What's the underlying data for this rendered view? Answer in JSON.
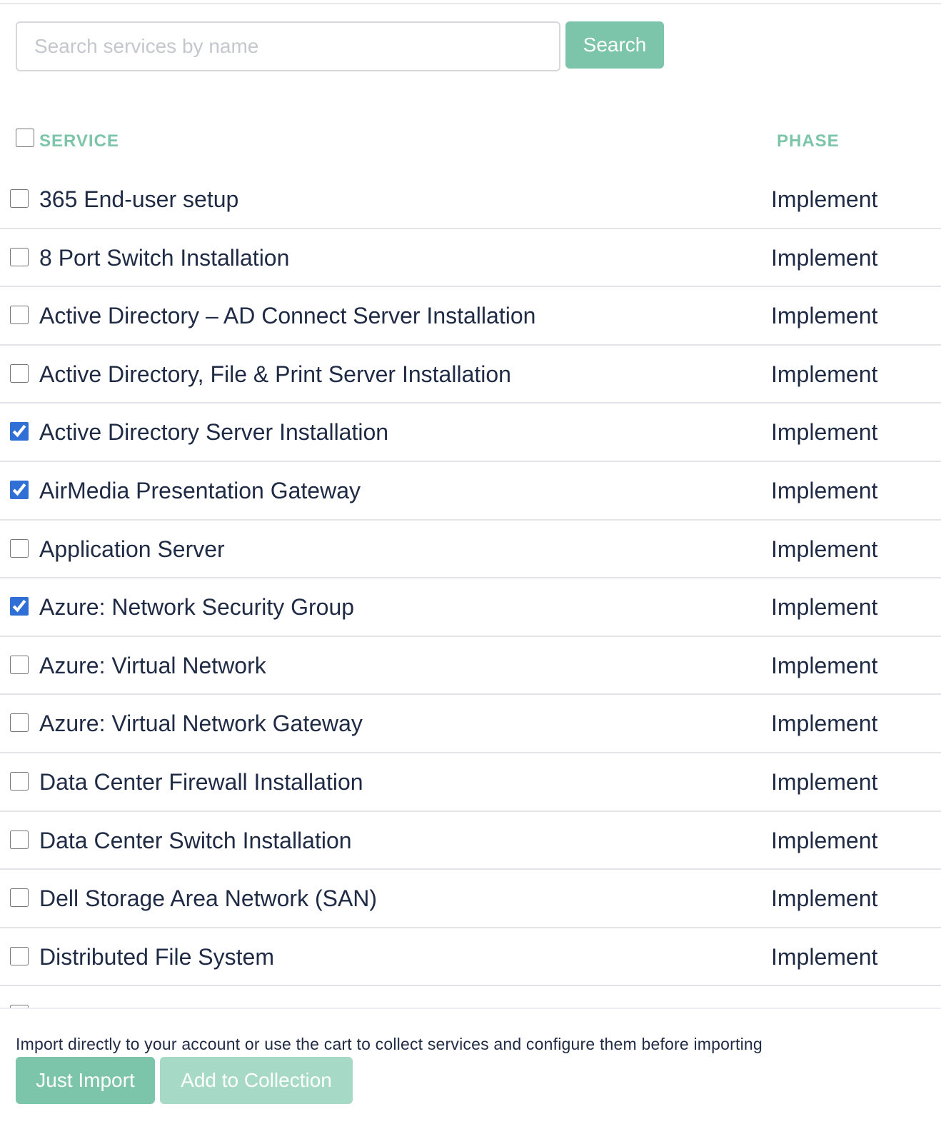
{
  "search": {
    "placeholder": "Search services by name",
    "value": "",
    "button_label": "Search"
  },
  "table": {
    "headers": {
      "service": "SERVICE",
      "phase": "PHASE"
    },
    "select_all_checked": false,
    "rows": [
      {
        "name": "365 End-user setup",
        "phase": "Implement",
        "checked": false
      },
      {
        "name": "8 Port Switch Installation",
        "phase": "Implement",
        "checked": false
      },
      {
        "name": "Active Directory – AD Connect Server Installation",
        "phase": "Implement",
        "checked": false
      },
      {
        "name": "Active Directory, File & Print Server Installation",
        "phase": "Implement",
        "checked": false
      },
      {
        "name": "Active Directory Server Installation",
        "phase": "Implement",
        "checked": true
      },
      {
        "name": "AirMedia Presentation Gateway",
        "phase": "Implement",
        "checked": true
      },
      {
        "name": "Application Server",
        "phase": "Implement",
        "checked": false
      },
      {
        "name": "Azure: Network Security Group",
        "phase": "Implement",
        "checked": true
      },
      {
        "name": "Azure: Virtual Network",
        "phase": "Implement",
        "checked": false
      },
      {
        "name": "Azure: Virtual Network Gateway",
        "phase": "Implement",
        "checked": false
      },
      {
        "name": "Data Center Firewall Installation",
        "phase": "Implement",
        "checked": false
      },
      {
        "name": "Data Center Switch Installation",
        "phase": "Implement",
        "checked": false
      },
      {
        "name": "Dell Storage Area Network (SAN)",
        "phase": "Implement",
        "checked": false
      },
      {
        "name": "Distributed File System",
        "phase": "Implement",
        "checked": false
      }
    ]
  },
  "footer": {
    "note": "Import directly to your account or use the cart to collect services and configure them before importing",
    "import_label": "Just Import",
    "collection_label": "Add to Collection"
  },
  "colors": {
    "accent": "#7cc5aa",
    "accent_light": "#a6dac6",
    "checkbox_checked": "#2f6fd6",
    "text": "#1f2a44"
  }
}
